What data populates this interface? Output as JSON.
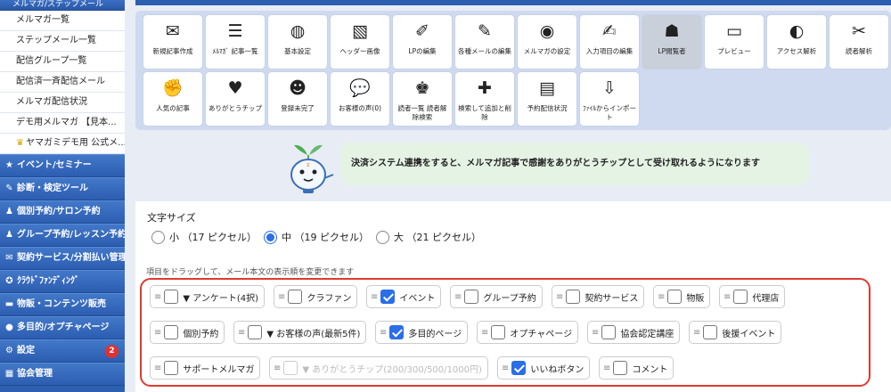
{
  "sidebar": {
    "top_label": "メルマガ/ステップメール",
    "sub_items": [
      {
        "label": "メルマガ一覧"
      },
      {
        "label": "ステップメール一覧"
      },
      {
        "label": "配信グループ一覧"
      },
      {
        "label": "配信済一斉配信メール"
      },
      {
        "label": "メルマガ配信状況"
      },
      {
        "label": "デモ用メルマガ 【見本..."
      },
      {
        "label": "ヤマガミデモ用 公式メ..."
      }
    ],
    "main_items": [
      {
        "label": "イベント/セミナー",
        "icon": "star-icon",
        "glyph": "★"
      },
      {
        "label": "診断・検定ツール",
        "icon": "wand-icon",
        "glyph": "✎"
      },
      {
        "label": "個別予約/サロン予約",
        "icon": "person-icon",
        "glyph": "♟"
      },
      {
        "label": "グループ予約/レッスン予約",
        "icon": "group-icon",
        "glyph": "♟"
      },
      {
        "label": "契約サービス/分割払い管理",
        "icon": "contract-icon",
        "glyph": "✉"
      },
      {
        "label": "ｸﾗｳﾄﾞﾌｧﾝﾃﾞｨﾝｸﾞ",
        "icon": "crowdfunding-icon",
        "glyph": "✪"
      },
      {
        "label": "物販・コンテンツ販売",
        "icon": "cart-icon",
        "glyph": "▬"
      },
      {
        "label": "多目的/オプチャページ",
        "icon": "circle-icon",
        "glyph": "●"
      },
      {
        "label": "設定",
        "icon": "gear-icon",
        "glyph": "⚙",
        "badge": "2"
      },
      {
        "label": "協会管理",
        "icon": "org-icon",
        "glyph": "▦"
      }
    ]
  },
  "toolbar": {
    "tiles": [
      {
        "label": "新規記事作成",
        "icon": "new-article-icon",
        "glyph": "✉"
      },
      {
        "label": "ﾒﾙﾏｶﾞ 記事一覧",
        "icon": "article-list-icon",
        "glyph": "☰"
      },
      {
        "label": "基本設定",
        "icon": "settings-doc-icon",
        "glyph": "◍"
      },
      {
        "label": "ヘッダー画像",
        "icon": "header-image-icon",
        "glyph": "▧"
      },
      {
        "label": "LPの編集",
        "icon": "lp-edit-icon",
        "glyph": "✐"
      },
      {
        "label": "各種メールの編集",
        "icon": "mail-edit-icon",
        "glyph": "✎"
      },
      {
        "label": "メルマガの設定",
        "icon": "mailmag-settings-icon",
        "glyph": "◉"
      },
      {
        "label": "入力項目の編集",
        "icon": "form-edit-icon",
        "glyph": "✍"
      },
      {
        "label": "LP閲覧者",
        "icon": "footprint-icon",
        "glyph": "☗"
      },
      {
        "label": "プレビュー",
        "icon": "preview-icon",
        "glyph": "▭"
      },
      {
        "label": "アクセス解析",
        "icon": "analytics-icon",
        "glyph": "◐"
      },
      {
        "label": "読者解析",
        "icon": "reader-analysis-icon",
        "glyph": "✂"
      },
      {
        "label": "人気の記事",
        "icon": "popular-icon",
        "glyph": "✊"
      },
      {
        "label": "ありがとうチップ",
        "icon": "heart-icon",
        "glyph": "♥"
      },
      {
        "label": "登録未完了",
        "icon": "incomplete-user-icon",
        "glyph": "☻"
      },
      {
        "label": "お客様の声(0)",
        "icon": "speech-bubble-icon",
        "glyph": "💬"
      },
      {
        "label": "読者一覧 読者解除検索",
        "icon": "reader-list-icon",
        "glyph": "♚"
      },
      {
        "label": "検索して追加と削除",
        "icon": "search-add-icon",
        "glyph": "✚"
      },
      {
        "label": "予約配信状況",
        "icon": "schedule-icon",
        "glyph": "▤"
      },
      {
        "label": "ﾌｧｲﾙからインポート",
        "icon": "csv-import-icon",
        "glyph": "⇩"
      }
    ]
  },
  "notice": {
    "text": "決済システム連携をすると、メルマガ記事で感謝をありがとうチップとして受け取れるようになります"
  },
  "font_size": {
    "label": "文字サイズ",
    "options": [
      {
        "label": "小 （17 ピクセル）",
        "selected": false
      },
      {
        "label": "中 （19 ピクセル）",
        "selected": true
      },
      {
        "label": "大 （21 ピクセル）",
        "selected": false
      }
    ]
  },
  "drag_hint": "項目をドラッグして、メール本文の表示順を変更できます",
  "items": [
    {
      "label": "▼ アンケート(4択)",
      "checked": false,
      "disabled": false
    },
    {
      "label": "クラファン",
      "checked": false,
      "disabled": false
    },
    {
      "label": "イベント",
      "checked": true,
      "disabled": false
    },
    {
      "label": "グループ予約",
      "checked": false,
      "disabled": false
    },
    {
      "label": "契約サービス",
      "checked": false,
      "disabled": false
    },
    {
      "label": "物販",
      "checked": false,
      "disabled": false
    },
    {
      "label": "代理店",
      "checked": false,
      "disabled": false
    },
    {
      "label": "個別予約",
      "checked": false,
      "disabled": false
    },
    {
      "label": "▼ お客様の声(最新5件)",
      "checked": false,
      "disabled": false
    },
    {
      "label": "多目的ページ",
      "checked": true,
      "disabled": false
    },
    {
      "label": "オプチャページ",
      "checked": false,
      "disabled": false
    },
    {
      "label": "協会認定講座",
      "checked": false,
      "disabled": false
    },
    {
      "label": "後援イベント",
      "checked": false,
      "disabled": false
    },
    {
      "label": "サポートメルマガ",
      "checked": false,
      "disabled": false
    },
    {
      "label": "▼ ありがとうチップ(200/300/500/1000円)",
      "checked": false,
      "disabled": true
    },
    {
      "label": "いいねボタン",
      "checked": true,
      "disabled": false
    },
    {
      "label": "コメント",
      "checked": false,
      "disabled": false
    }
  ],
  "colors": {
    "sidebar": "#2d5fb0",
    "highlight": "#e03a2e",
    "accent": "#2a6ee8"
  }
}
